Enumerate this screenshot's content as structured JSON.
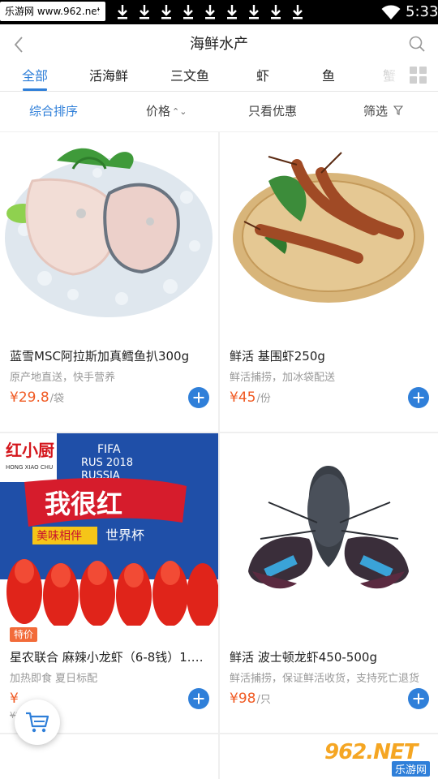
{
  "status_bar": {
    "watermark": "乐游网 www.962.net",
    "time": "5:33",
    "icons": [
      "download-arrow-icon",
      "wifi-icon"
    ]
  },
  "header": {
    "title": "海鲜水产",
    "back_icon": "chevron-left-icon",
    "search_icon": "search-icon"
  },
  "tabs": [
    {
      "label": "全部",
      "active": true
    },
    {
      "label": "活海鲜",
      "active": false
    },
    {
      "label": "三文鱼",
      "active": false
    },
    {
      "label": "虾",
      "active": false
    },
    {
      "label": "鱼",
      "active": false
    },
    {
      "label": "蟹",
      "active": false
    }
  ],
  "sort_bar": {
    "items": [
      {
        "label": "综合排序",
        "active": true
      },
      {
        "label": "价格",
        "icon": "sort-updown-icon"
      },
      {
        "label": "只看优惠"
      },
      {
        "label": "筛选",
        "icon": "filter-icon"
      }
    ]
  },
  "products": [
    {
      "name": "蓝雪MSC阿拉斯加真鳕鱼扒300g",
      "desc": "原产地直送，快手营养",
      "price": "¥29.8",
      "unit": "/袋"
    },
    {
      "name": "鲜活 基围虾250g",
      "desc": "鲜活捕捞，加冰袋配送",
      "price": "¥45",
      "unit": "/份"
    },
    {
      "name": "星农联合 麻辣小龙虾（6-8钱）1.…",
      "desc": "加热即食  夏日标配",
      "price": "¥",
      "unit": "",
      "original_price": "¥9",
      "tag": "特价",
      "image_text": {
        "brand": "红小厨",
        "brand_en": "HONG XIAO CHU",
        "headline": "我很红",
        "sub1": "美味相伴",
        "sub2": "世界杯",
        "fifa": "FIFA",
        "rus": "RUS 2018",
        "russia": "RUSSIA"
      }
    },
    {
      "name": "鲜活 波士顿龙虾450-500g",
      "desc": "鲜活捕捞，保证鲜活收货，支持死亡退货",
      "price": "¥98",
      "unit": "/只"
    }
  ],
  "cart": {
    "icon": "cart-icon"
  },
  "watermark_logo": {
    "top": "962.NET",
    "bottom": "乐游网"
  },
  "colors": {
    "accent": "#2f7fd9",
    "price": "#f05a23",
    "tag": "#f26b3a"
  }
}
